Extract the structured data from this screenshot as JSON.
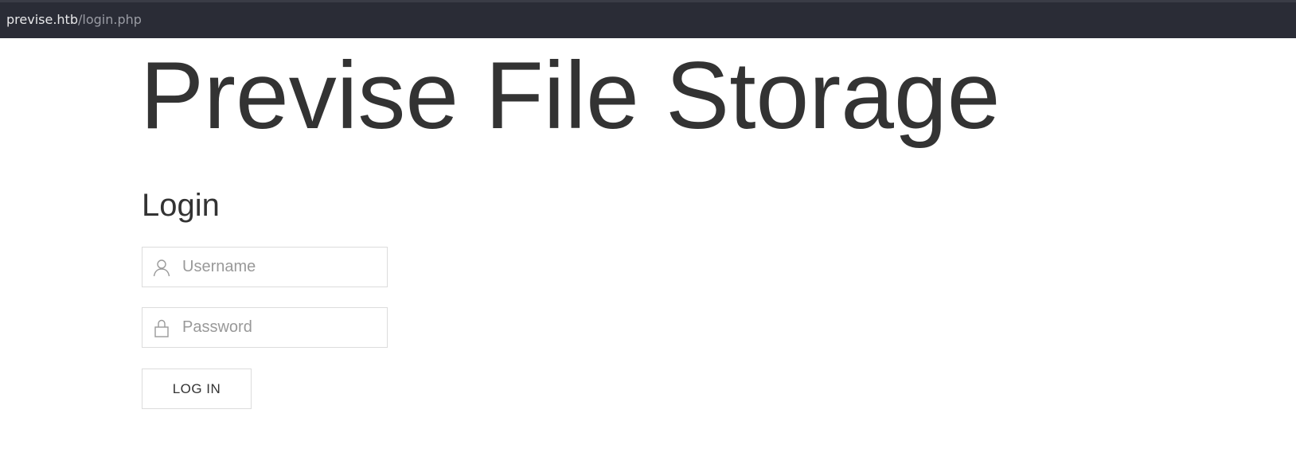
{
  "browser": {
    "url_host": "previse.htb",
    "url_path": "/login.php"
  },
  "page": {
    "title": "Previse File Storage",
    "login_heading": "Login"
  },
  "form": {
    "username_placeholder": "Username",
    "username_value": "",
    "password_placeholder": "Password",
    "password_value": "",
    "submit_label": "LOG IN"
  },
  "icons": {
    "username": "user-icon",
    "password": "lock-icon"
  },
  "colors": {
    "url_bar_bg": "#2a2c36",
    "text": "#333333",
    "placeholder": "#999999",
    "border": "#dcdcdc"
  }
}
